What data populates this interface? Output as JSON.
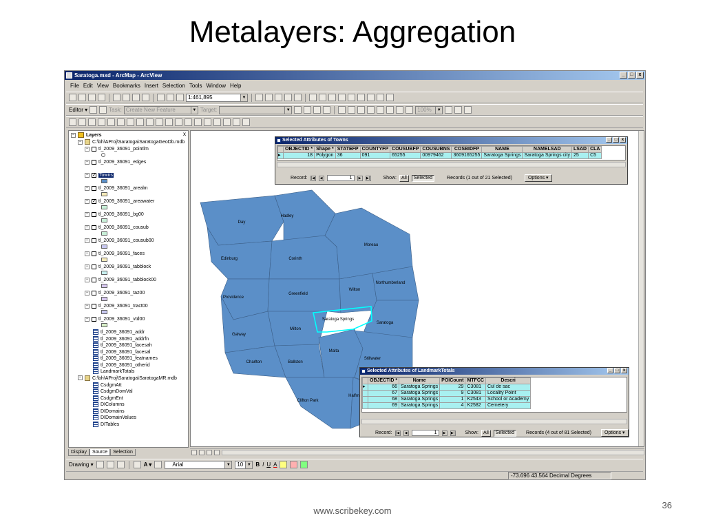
{
  "slide": {
    "title": "Metalayers: Aggregation",
    "footer": "www.scribekey.com",
    "page_number": "36"
  },
  "window": {
    "title": "Saratoga.mxd - ArcMap - ArcView",
    "min_btn": "_",
    "max_btn": "□",
    "close_btn": "x",
    "menu": [
      "File",
      "Edit",
      "View",
      "Bookmarks",
      "Insert",
      "Selection",
      "Tools",
      "Window",
      "Help"
    ]
  },
  "toolbar": {
    "scale": "1:461,895",
    "editor_label": "Editor ▾",
    "task_label": "Task:",
    "task_value": "Create New Feature",
    "target_label": "Target:",
    "zoom_value": "100%"
  },
  "toc": {
    "close_glyph": "x",
    "root": "Layers",
    "db1": "C:\\bh\\AProj\\Saratoga\\SaratogaGeoDb.mdb",
    "layers": [
      {
        "name": "tl_2009_36091_pointlm",
        "checked": false,
        "swatch": "#ffffff"
      },
      {
        "name": "tl_2009_36091_edges",
        "checked": false,
        "swatch": ""
      },
      {
        "name": "Towns",
        "checked": true,
        "swatch": "#5b8fc8",
        "selected": true
      },
      {
        "name": "tl_2009_36091_arealm",
        "checked": false,
        "swatch": "#f5e9b8"
      },
      {
        "name": "tl_2009_36091_areawater",
        "checked": true,
        "swatch": "#c8f0d8"
      },
      {
        "name": "tl_2009_36091_bg00",
        "checked": false,
        "swatch": "#c8f0d8"
      },
      {
        "name": "tl_2009_36091_cousub",
        "checked": false,
        "swatch": "#c8f0d8"
      },
      {
        "name": "tl_2009_36091_cousub00",
        "checked": false,
        "swatch": "#c8c8f0"
      },
      {
        "name": "tl_2009_36091_faces",
        "checked": false,
        "swatch": "#f5e9b8"
      },
      {
        "name": "tl_2009_36091_tabblock",
        "checked": false,
        "swatch": "#c8f0f0"
      },
      {
        "name": "tl_2009_36091_tabblock00",
        "checked": false,
        "swatch": "#d8c8f0"
      },
      {
        "name": "tl_2009_36091_taz00",
        "checked": false,
        "swatch": "#d8c8f0"
      },
      {
        "name": "tl_2009_36091_tract00",
        "checked": false,
        "swatch": "#c8c8f0"
      },
      {
        "name": "tl_2009_36091_vtd00",
        "checked": false,
        "swatch": "#d8f0c8"
      }
    ],
    "tables1": [
      "tl_2009_36091_addr",
      "tl_2009_36091_addrfn",
      "tl_2009_36091_facesah",
      "tl_2009_36091_facesal",
      "tl_2009_36091_featnames",
      "tl_2009_36091_otherid",
      "LandmarkTotals"
    ],
    "db2": "C:\\bh\\AProj\\Saratoga\\SaratogaMR.mdb",
    "tables2": [
      "CsdgmAtt",
      "CsdgmDomVal",
      "CsdgmEnt",
      "DIColumns",
      "DIDomains",
      "DIDomainValues",
      "DITables"
    ],
    "tabs": [
      "Display",
      "Source",
      "Selection"
    ]
  },
  "map": {
    "fill": "#5b8fc8",
    "highlight": "#00ffff",
    "towns": [
      "Day",
      "Hadley",
      "Edinburg",
      "Corinth",
      "Moreau",
      "Providence",
      "Greenfield",
      "Wilton",
      "Northumberland",
      "Galway",
      "Milton",
      "Saratoga Springs",
      "Saratoga",
      "Charlton",
      "Ballston",
      "Malta",
      "Stillwater",
      "Clifton Park",
      "Halfmoon"
    ]
  },
  "towns_table": {
    "title": "Selected Attributes of Towns",
    "columns": [
      "OBJECTID *",
      "Shape *",
      "STATEFP",
      "COUNTYFP",
      "COUSUBFP",
      "COUSUBNS",
      "COSBIDFP",
      "NAME",
      "NAMELSAD",
      "LSAD",
      "CLA"
    ],
    "rows": [
      [
        "18",
        "Polygon",
        "36",
        "091",
        "65255",
        "00979462",
        "3609165255",
        "Saratoga Springs",
        "Saratoga Springs city",
        "25",
        "C5"
      ]
    ],
    "record_label": "Record:",
    "record_value": "1",
    "show_label": "Show:",
    "all_btn": "All",
    "selected_btn": "Selected",
    "records_text": "Records (1 out of 21 Selected)",
    "options_btn": "Options ▾"
  },
  "landmark_table": {
    "title": "Selected Attributes of LandmarkTotals",
    "columns": [
      "OBJECTID *",
      "Name",
      "POICount",
      "MTFCC",
      "Descri"
    ],
    "rows": [
      [
        "66",
        "Saratoga Springs",
        "29",
        "C3081",
        "Cul de sac"
      ],
      [
        "67",
        "Saratoga Springs",
        "9",
        "C3081",
        "Locality Point"
      ],
      [
        "68",
        "Saratoga Springs",
        "1",
        "K2543",
        "School or Academy"
      ],
      [
        "69",
        "Saratoga Springs",
        "4",
        "K2582",
        "Cemetery"
      ]
    ],
    "record_label": "Record:",
    "record_value": "1",
    "show_label": "Show:",
    "all_btn": "All",
    "selected_btn": "Selected",
    "records_text": "Records (4 out of 81 Selected)",
    "options_btn": "Options ▾"
  },
  "drawing": {
    "drawing_label": "Drawing ▾",
    "font_name": "Arial",
    "font_size": "10",
    "bold": "B",
    "italic": "I",
    "underline": "U",
    "font_color": "A"
  },
  "status": {
    "coords": "-73.696  43.564 Decimal Degrees"
  }
}
